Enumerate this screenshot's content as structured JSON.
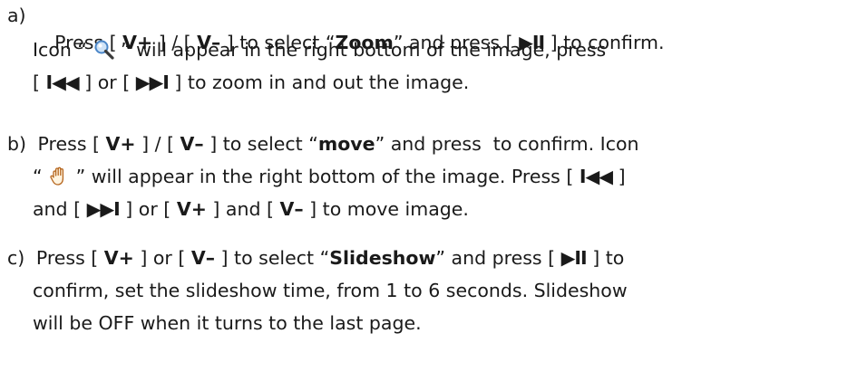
{
  "items": [
    {
      "marker": "a)",
      "lines": [
        [
          "Press [ ",
          {
            "b": "V+"
          },
          " ] / [ ",
          {
            "b": "V–"
          },
          " ] to select “",
          {
            "b": "Zoom"
          },
          "” and press [ ",
          {
            "g": "▶II"
          },
          " ] to confirm."
        ],
        [
          "Icon “ ",
          {
            "icon": "magnifier-icon"
          },
          " ” will appear in the right bottom of the image, press"
        ],
        [
          "[ ",
          {
            "g": "I◀◀"
          },
          " ] or [ ",
          {
            "g": "▶▶I"
          },
          " ] to zoom in and out the image."
        ]
      ]
    },
    {
      "marker": "b)",
      "lines": [
        [
          "Press [ ",
          {
            "b": "V+"
          },
          " ] / [ ",
          {
            "b": "V–"
          },
          " ] to select “",
          {
            "b": "move"
          },
          "” and press  to confirm. Icon"
        ],
        [
          "“ ",
          {
            "icon": "hand-icon"
          },
          " ” will appear in the right bottom of the image. Press [ ",
          {
            "g": "I◀◀"
          },
          " ]"
        ],
        [
          "and [ ",
          {
            "g": "▶▶I"
          },
          " ] or [ ",
          {
            "b": "V+"
          },
          " ] and [ ",
          {
            "b": "V–"
          },
          " ] to move image."
        ]
      ]
    },
    {
      "marker": "c)",
      "lines": [
        [
          "Press [ ",
          {
            "b": "V+"
          },
          " ] or [ ",
          {
            "b": "V–"
          },
          " ] to select “",
          {
            "b": "Slideshow"
          },
          "” and press [ ",
          {
            "g": "▶II"
          },
          " ] to"
        ],
        [
          "confirm, set the slideshow time, from 1 to 6 seconds. Slideshow"
        ],
        [
          "will be OFF when it turns to the last page."
        ]
      ]
    }
  ],
  "icons": {
    "magnifier": "magnifier-icon",
    "hand": "hand-icon"
  },
  "colors": {
    "text": "#1a1a1a",
    "magnifier_lens": "#4a86c8",
    "hand_outline": "#b5651d"
  }
}
